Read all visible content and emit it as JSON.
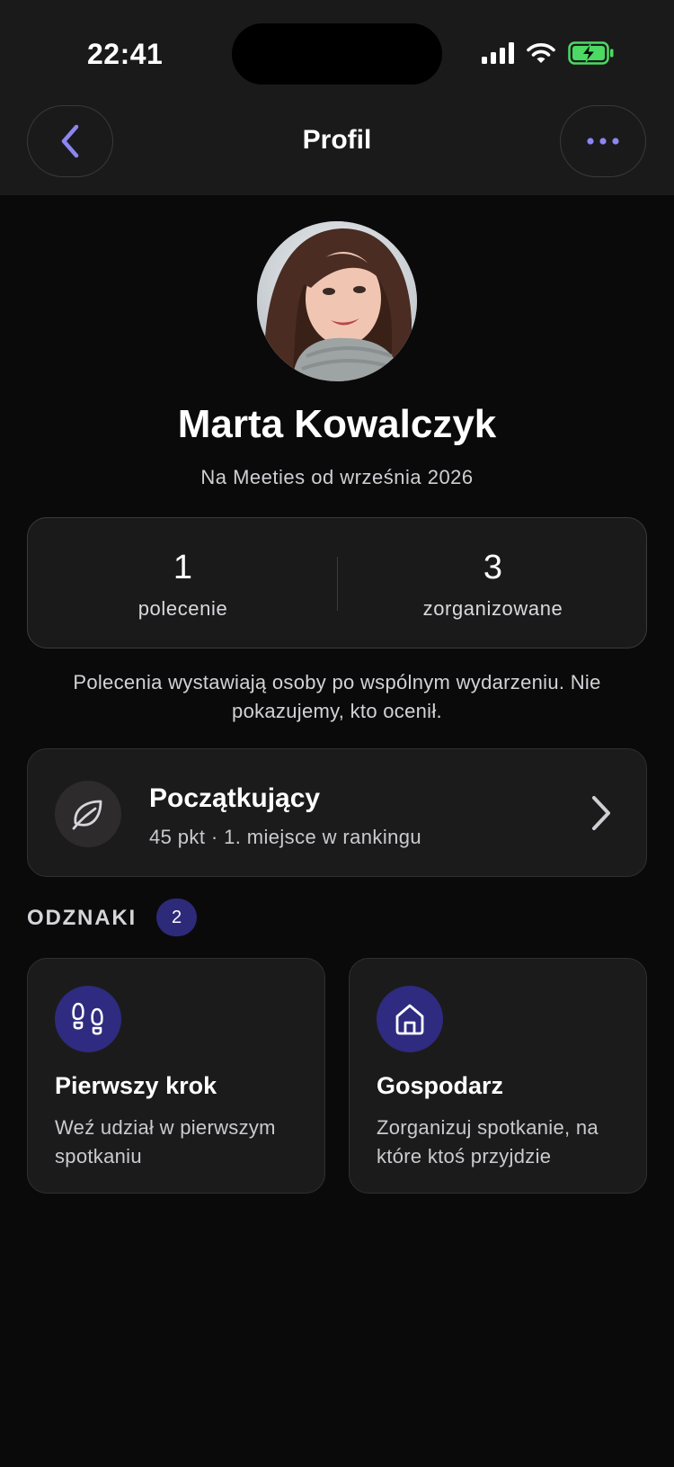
{
  "status_bar": {
    "time": "22:41"
  },
  "nav": {
    "title": "Profil"
  },
  "profile": {
    "name": "Marta Kowalczyk",
    "member_since": "Na Meeties od września 2026"
  },
  "stats": [
    {
      "value": "1",
      "label": "polecenie"
    },
    {
      "value": "3",
      "label": "zorganizowane"
    }
  ],
  "note": "Polecenia wystawiają osoby po wspólnym wydarzeniu. Nie pokazujemy, kto ocenił.",
  "level": {
    "title": "Początkujący",
    "subtitle": "45 pkt · 1. miejsce w rankingu",
    "icon": "leaf-icon"
  },
  "badges_section": {
    "title": "ODZNAKI",
    "count": "2",
    "items": [
      {
        "title": "Pierwszy krok",
        "description": "Weź udział w pierwszym spotkaniu",
        "icon": "footprints-icon"
      },
      {
        "title": "Gospodarz",
        "description": "Zorganizuj spotkanie, na które ktoś przyjdzie",
        "icon": "home-icon"
      }
    ]
  },
  "colors": {
    "accent": "#8b86f2",
    "badge_bg": "#2e2b80",
    "battery_green": "#4cd964",
    "background": "#0b0a0a",
    "card": "#1c1b1b"
  }
}
